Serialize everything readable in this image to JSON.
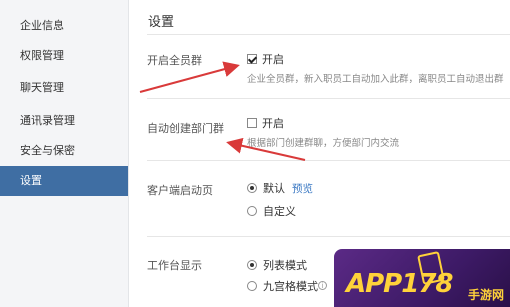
{
  "sidebar": {
    "items": [
      {
        "label": "企业信息",
        "active": false
      },
      {
        "label": "权限管理",
        "active": false
      },
      {
        "label": "聊天管理",
        "active": false
      },
      {
        "label": "通讯录管理",
        "active": false
      },
      {
        "label": "安全与保密",
        "active": false
      },
      {
        "label": "设置",
        "active": true
      }
    ]
  },
  "main": {
    "title": "设置",
    "all_staff_group": {
      "label": "开启全员群",
      "option": "开启",
      "checked": true,
      "hint": "企业全员群，新入职员工自动加入此群，离职员工自动退出群"
    },
    "auto_dept_group": {
      "label": "自动创建部门群",
      "option": "开启",
      "checked": false,
      "hint": "根据部门创建群聊，方便部门内交流"
    },
    "client_start_page": {
      "label": "客户端启动页",
      "options": [
        "默认",
        "自定义"
      ],
      "selected": "默认",
      "preview_link": "预览"
    },
    "workbench_display": {
      "label": "工作台显示",
      "options": [
        "列表模式",
        "九宫格模式"
      ],
      "selected": "列表模式"
    }
  },
  "watermark": {
    "text": "APP178",
    "sub": "手游网"
  },
  "colors": {
    "sidebar_bg": "#f4f5f7",
    "active_bg": "#3f6ea3",
    "arrow": "#d93a3a",
    "link": "#3a78c3"
  }
}
